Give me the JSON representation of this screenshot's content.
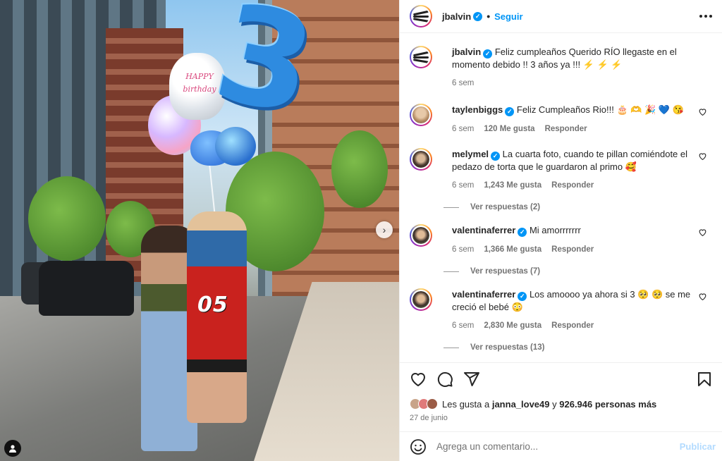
{
  "post": {
    "username": "jbalvin",
    "follow_label": "Seguir",
    "caption": "Feliz cumpleaños Querido RÍO llegaste en el momento debido !! 3 años ya !!! ⚡ ⚡ ⚡",
    "caption_time": "6 sem",
    "photo_jersey_number": "05"
  },
  "comments": [
    {
      "username": "taylenbiggs",
      "text": "Feliz Cumpleaños Rio!!! 🎂 🫶 🎉 💙 😘",
      "time": "6 sem",
      "likes": "120 Me gusta",
      "reply_label": "Responder",
      "avatar_color": "#c9a27d"
    },
    {
      "username": "melymel",
      "text": "La cuarta foto, cuando te pillan comiéndote el pedazo de torta que le guardaron al primo 🥰",
      "time": "6 sem",
      "likes": "1,243 Me gusta",
      "reply_label": "Responder",
      "view_replies": "Ver respuestas (2)",
      "avatar_color": "#5b4a40"
    },
    {
      "username": "valentinaferrer",
      "text": "Mi amorrrrrrr",
      "time": "6 sem",
      "likes": "1,366 Me gusta",
      "reply_label": "Responder",
      "view_replies": "Ver respuestas (7)",
      "avatar_color": "#3c2f2a"
    },
    {
      "username": "valentinaferrer",
      "text": "Los amoooo ya ahora si 3 🥺 🥺 se me creció el bebé 😳",
      "time": "6 sem",
      "likes": "2,830 Me gusta",
      "reply_label": "Responder",
      "view_replies": "Ver respuestas (13)",
      "avatar_color": "#3c2f2a"
    }
  ],
  "likes": {
    "prefix": "Les gusta a",
    "first_user": "janna_love49",
    "joiner": "y",
    "others": "926.946 personas más"
  },
  "date": "27 de junio",
  "add_comment": {
    "placeholder": "Agrega un comentario...",
    "publish_label": "Publicar"
  },
  "icons": {
    "like": "heart-icon",
    "comment": "comment-icon",
    "share": "share-icon",
    "save": "bookmark-icon",
    "emoji": "emoji-icon",
    "more": "more-options-icon",
    "next": "chevron-right-icon",
    "tag": "user-tag-icon"
  },
  "colors": {
    "accent": "#0095f6",
    "verified": "#0095f6",
    "muted": "#737373",
    "publish_disabled": "#b3dbff"
  }
}
